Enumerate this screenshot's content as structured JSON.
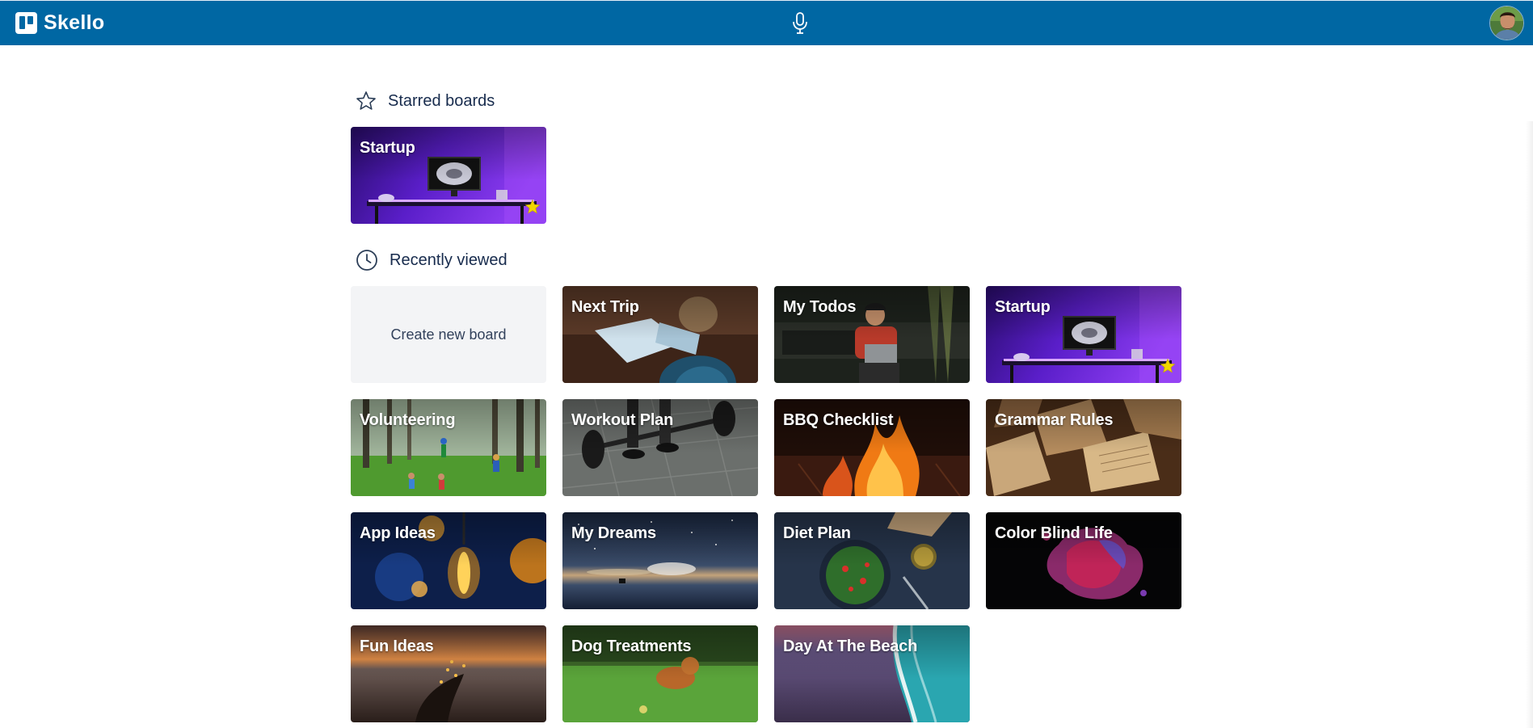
{
  "header": {
    "app_name": "Skello",
    "logo_icon": "board-logo-icon",
    "mic_icon": "microphone-icon",
    "avatar_icon": "user-avatar",
    "bg_color": "#0067a3"
  },
  "starred": {
    "title": "Starred boards",
    "icon": "star-outline-icon",
    "boards": [
      {
        "title": "Startup",
        "starred": true,
        "theme": "purple-desk"
      }
    ]
  },
  "recent": {
    "title": "Recently viewed",
    "icon": "clock-icon",
    "create_label": "Create new board",
    "boards": [
      {
        "title": "Next Trip",
        "starred": false,
        "theme": "map-boy"
      },
      {
        "title": "My Todos",
        "starred": false,
        "theme": "dark-lounge"
      },
      {
        "title": "Startup",
        "starred": true,
        "theme": "purple-desk"
      },
      {
        "title": "Volunteering",
        "starred": false,
        "theme": "forest-kids"
      },
      {
        "title": "Workout Plan",
        "starred": false,
        "theme": "barbell"
      },
      {
        "title": "BBQ Checklist",
        "starred": false,
        "theme": "fire"
      },
      {
        "title": "Grammar Rules",
        "starred": false,
        "theme": "books"
      },
      {
        "title": "App Ideas",
        "starred": false,
        "theme": "bulbs"
      },
      {
        "title": "My Dreams",
        "starred": false,
        "theme": "starry-lake"
      },
      {
        "title": "Diet Plan",
        "starred": false,
        "theme": "salad"
      },
      {
        "title": "Color Blind Life",
        "starred": false,
        "theme": "ink-splash"
      },
      {
        "title": "Fun Ideas",
        "starred": false,
        "theme": "sunset-hand"
      },
      {
        "title": "Dog Treatments",
        "starred": false,
        "theme": "dog-grass"
      },
      {
        "title": "Day At The Beach",
        "starred": false,
        "theme": "beach-waves"
      }
    ]
  },
  "colors": {
    "star_fill": "#f2d600",
    "create_tile_bg": "#f3f4f6",
    "text_dark": "#172b4d"
  }
}
